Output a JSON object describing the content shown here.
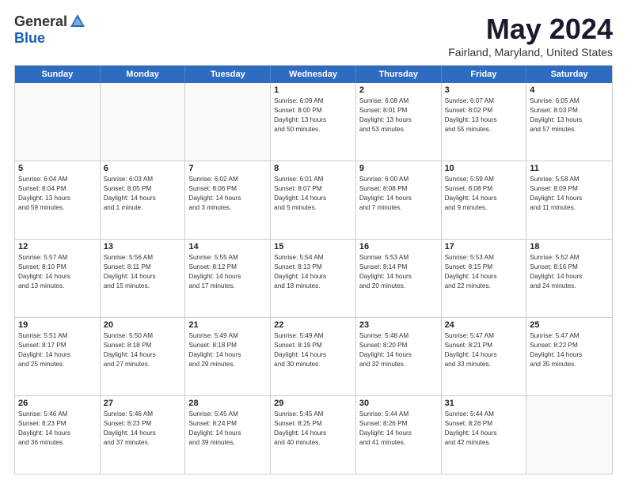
{
  "logo": {
    "general": "General",
    "blue": "Blue"
  },
  "title": "May 2024",
  "location": "Fairland, Maryland, United States",
  "days_of_week": [
    "Sunday",
    "Monday",
    "Tuesday",
    "Wednesday",
    "Thursday",
    "Friday",
    "Saturday"
  ],
  "weeks": [
    [
      {
        "day": "",
        "lines": []
      },
      {
        "day": "",
        "lines": []
      },
      {
        "day": "",
        "lines": []
      },
      {
        "day": "1",
        "lines": [
          "Sunrise: 6:09 AM",
          "Sunset: 8:00 PM",
          "Daylight: 13 hours",
          "and 50 minutes."
        ]
      },
      {
        "day": "2",
        "lines": [
          "Sunrise: 6:08 AM",
          "Sunset: 8:01 PM",
          "Daylight: 13 hours",
          "and 53 minutes."
        ]
      },
      {
        "day": "3",
        "lines": [
          "Sunrise: 6:07 AM",
          "Sunset: 8:02 PM",
          "Daylight: 13 hours",
          "and 55 minutes."
        ]
      },
      {
        "day": "4",
        "lines": [
          "Sunrise: 6:05 AM",
          "Sunset: 8:03 PM",
          "Daylight: 13 hours",
          "and 57 minutes."
        ]
      }
    ],
    [
      {
        "day": "5",
        "lines": [
          "Sunrise: 6:04 AM",
          "Sunset: 8:04 PM",
          "Daylight: 13 hours",
          "and 59 minutes."
        ]
      },
      {
        "day": "6",
        "lines": [
          "Sunrise: 6:03 AM",
          "Sunset: 8:05 PM",
          "Daylight: 14 hours",
          "and 1 minute."
        ]
      },
      {
        "day": "7",
        "lines": [
          "Sunrise: 6:02 AM",
          "Sunset: 8:06 PM",
          "Daylight: 14 hours",
          "and 3 minutes."
        ]
      },
      {
        "day": "8",
        "lines": [
          "Sunrise: 6:01 AM",
          "Sunset: 8:07 PM",
          "Daylight: 14 hours",
          "and 5 minutes."
        ]
      },
      {
        "day": "9",
        "lines": [
          "Sunrise: 6:00 AM",
          "Sunset: 8:08 PM",
          "Daylight: 14 hours",
          "and 7 minutes."
        ]
      },
      {
        "day": "10",
        "lines": [
          "Sunrise: 5:59 AM",
          "Sunset: 8:08 PM",
          "Daylight: 14 hours",
          "and 9 minutes."
        ]
      },
      {
        "day": "11",
        "lines": [
          "Sunrise: 5:58 AM",
          "Sunset: 8:09 PM",
          "Daylight: 14 hours",
          "and 11 minutes."
        ]
      }
    ],
    [
      {
        "day": "12",
        "lines": [
          "Sunrise: 5:57 AM",
          "Sunset: 8:10 PM",
          "Daylight: 14 hours",
          "and 13 minutes."
        ]
      },
      {
        "day": "13",
        "lines": [
          "Sunrise: 5:56 AM",
          "Sunset: 8:11 PM",
          "Daylight: 14 hours",
          "and 15 minutes."
        ]
      },
      {
        "day": "14",
        "lines": [
          "Sunrise: 5:55 AM",
          "Sunset: 8:12 PM",
          "Daylight: 14 hours",
          "and 17 minutes."
        ]
      },
      {
        "day": "15",
        "lines": [
          "Sunrise: 5:54 AM",
          "Sunset: 8:13 PM",
          "Daylight: 14 hours",
          "and 18 minutes."
        ]
      },
      {
        "day": "16",
        "lines": [
          "Sunrise: 5:53 AM",
          "Sunset: 8:14 PM",
          "Daylight: 14 hours",
          "and 20 minutes."
        ]
      },
      {
        "day": "17",
        "lines": [
          "Sunrise: 5:53 AM",
          "Sunset: 8:15 PM",
          "Daylight: 14 hours",
          "and 22 minutes."
        ]
      },
      {
        "day": "18",
        "lines": [
          "Sunrise: 5:52 AM",
          "Sunset: 8:16 PM",
          "Daylight: 14 hours",
          "and 24 minutes."
        ]
      }
    ],
    [
      {
        "day": "19",
        "lines": [
          "Sunrise: 5:51 AM",
          "Sunset: 8:17 PM",
          "Daylight: 14 hours",
          "and 25 minutes."
        ]
      },
      {
        "day": "20",
        "lines": [
          "Sunrise: 5:50 AM",
          "Sunset: 8:18 PM",
          "Daylight: 14 hours",
          "and 27 minutes."
        ]
      },
      {
        "day": "21",
        "lines": [
          "Sunrise: 5:49 AM",
          "Sunset: 8:18 PM",
          "Daylight: 14 hours",
          "and 29 minutes."
        ]
      },
      {
        "day": "22",
        "lines": [
          "Sunrise: 5:49 AM",
          "Sunset: 8:19 PM",
          "Daylight: 14 hours",
          "and 30 minutes."
        ]
      },
      {
        "day": "23",
        "lines": [
          "Sunrise: 5:48 AM",
          "Sunset: 8:20 PM",
          "Daylight: 14 hours",
          "and 32 minutes."
        ]
      },
      {
        "day": "24",
        "lines": [
          "Sunrise: 5:47 AM",
          "Sunset: 8:21 PM",
          "Daylight: 14 hours",
          "and 33 minutes."
        ]
      },
      {
        "day": "25",
        "lines": [
          "Sunrise: 5:47 AM",
          "Sunset: 8:22 PM",
          "Daylight: 14 hours",
          "and 35 minutes."
        ]
      }
    ],
    [
      {
        "day": "26",
        "lines": [
          "Sunrise: 5:46 AM",
          "Sunset: 8:23 PM",
          "Daylight: 14 hours",
          "and 36 minutes."
        ]
      },
      {
        "day": "27",
        "lines": [
          "Sunrise: 5:46 AM",
          "Sunset: 8:23 PM",
          "Daylight: 14 hours",
          "and 37 minutes."
        ]
      },
      {
        "day": "28",
        "lines": [
          "Sunrise: 5:45 AM",
          "Sunset: 8:24 PM",
          "Daylight: 14 hours",
          "and 39 minutes."
        ]
      },
      {
        "day": "29",
        "lines": [
          "Sunrise: 5:45 AM",
          "Sunset: 8:25 PM",
          "Daylight: 14 hours",
          "and 40 minutes."
        ]
      },
      {
        "day": "30",
        "lines": [
          "Sunrise: 5:44 AM",
          "Sunset: 8:26 PM",
          "Daylight: 14 hours",
          "and 41 minutes."
        ]
      },
      {
        "day": "31",
        "lines": [
          "Sunrise: 5:44 AM",
          "Sunset: 8:26 PM",
          "Daylight: 14 hours",
          "and 42 minutes."
        ]
      },
      {
        "day": "",
        "lines": []
      }
    ]
  ]
}
